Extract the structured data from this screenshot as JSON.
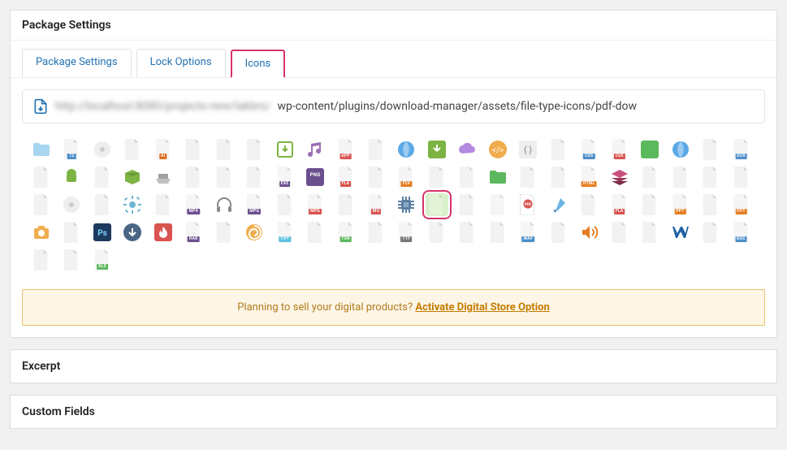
{
  "panel_title": "Package Settings",
  "tabs": {
    "package_settings": "Package Settings",
    "lock_options": "Lock Options",
    "icons": "Icons"
  },
  "path": {
    "blurred_prefix": "http://localhost:8080/projects-new/lakbrs/",
    "visible_suffix": "wp-content/plugins/download-manager/assets/file-type-icons/pdf-dow"
  },
  "icons": {
    "rows": [
      [
        "folder",
        "7z",
        "disc",
        "file",
        "ai",
        "file",
        "file",
        "file",
        "download-box",
        "music",
        "app",
        "file",
        "globe",
        "down-green",
        "cloud",
        "code",
        "brackets",
        "file",
        "file-css",
        "file-cue",
        "folder-green",
        "globe2",
        "file",
        "file-dcr",
        "file"
      ],
      [
        "android",
        "file",
        "box-green",
        "tray",
        "file",
        "file",
        "file",
        "file-exe",
        "png",
        "file-fla",
        "file",
        "file-flv",
        "file",
        "file",
        "folder-green2",
        "file",
        "file",
        "file-html",
        "layers",
        "file",
        "file",
        "file",
        "file",
        "file",
        "disc2"
      ],
      [
        "file",
        "gear",
        "file",
        "file-mp4",
        "headphones",
        "file-mpg",
        "file",
        "file-mpg2",
        "file",
        "file-mu",
        "cpu",
        "pdf-selected",
        "file",
        "file-red",
        "pdf",
        "brush",
        "file",
        "file-fla2",
        "file",
        "file-ppt",
        "file",
        "file-ppt2",
        "camera",
        "file",
        "ps"
      ],
      [
        "down-circle",
        "flame",
        "file-rar",
        "file",
        "swirl",
        "file-tiff",
        "file",
        "file-torrent",
        "file",
        "file-ttf",
        "file",
        "file",
        "file",
        "file-wav",
        "file",
        "sound",
        "file",
        "file",
        "vv",
        "file",
        "file-doc",
        "file",
        "file",
        "file-xls"
      ]
    ],
    "selected": "pdf-selected"
  },
  "promo": {
    "text": "Planning to sell your digital products? ",
    "link_text": "Activate Digital Store Option"
  },
  "collapsed_panels": {
    "excerpt": "Excerpt",
    "custom_fields": "Custom Fields"
  }
}
